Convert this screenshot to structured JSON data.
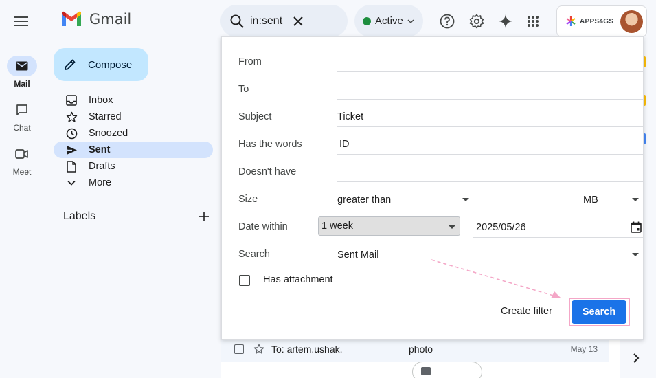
{
  "app": {
    "name": "Gmail"
  },
  "search": {
    "query": "in:sent"
  },
  "status": {
    "label": "Active",
    "color": "#1e8e3e"
  },
  "account": {
    "brand": "APPS4GS"
  },
  "rail": [
    {
      "label": "Mail",
      "icon": "mail-icon"
    },
    {
      "label": "Chat",
      "icon": "chat-icon"
    },
    {
      "label": "Meet",
      "icon": "video-icon"
    }
  ],
  "sidebar": {
    "compose_label": "Compose",
    "items": [
      {
        "label": "Inbox",
        "icon": "inbox-icon"
      },
      {
        "label": "Starred",
        "icon": "star-icon"
      },
      {
        "label": "Snoozed",
        "icon": "clock-icon"
      },
      {
        "label": "Sent",
        "icon": "send-icon",
        "active": true
      },
      {
        "label": "Drafts",
        "icon": "draft-icon"
      },
      {
        "label": "More",
        "icon": "chevron-down-icon"
      }
    ],
    "labels_heading": "Labels"
  },
  "advanced_search": {
    "from_label": "From",
    "from_value": "",
    "to_label": "To",
    "to_value": "",
    "subject_label": "Subject",
    "subject_value": "Ticket",
    "has_words_label": "Has the words",
    "has_words_value": "ID",
    "doesnt_have_label": "Doesn't have",
    "doesnt_have_value": "",
    "size_label": "Size",
    "size_operator": "greater than",
    "size_value": "",
    "size_unit": "MB",
    "date_within_label": "Date within",
    "date_within_value": "1 week",
    "date_value": "2025/05/26",
    "search_in_label": "Search",
    "search_in_value": "Sent Mail",
    "has_attachment_label": "Has attachment",
    "create_filter_label": "Create filter",
    "search_button_label": "Search"
  },
  "email_row": {
    "sender": "To: artem.ushak.",
    "subject": "photo",
    "date": "May 13"
  }
}
